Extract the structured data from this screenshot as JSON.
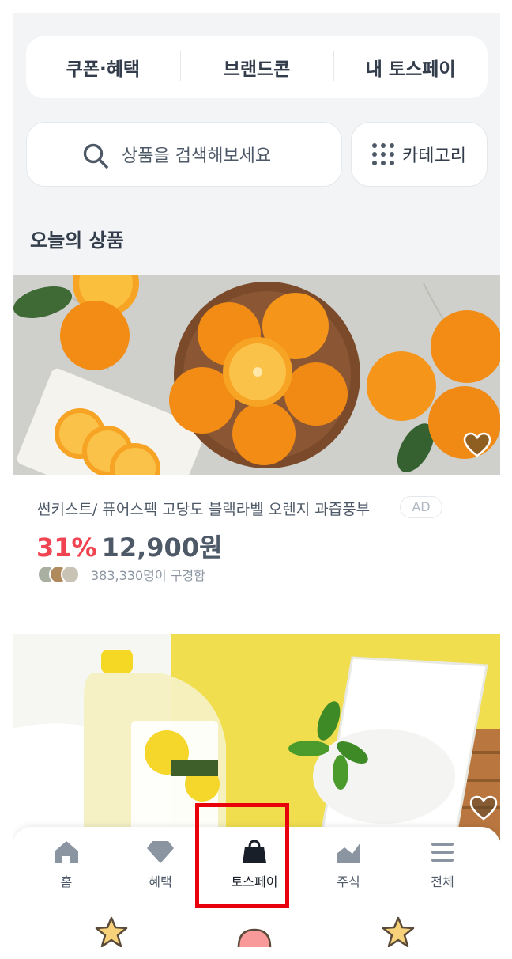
{
  "top_tabs": [
    "쿠폰·혜택",
    "브랜드콘",
    "내 토스페이"
  ],
  "search": {
    "placeholder": "상품을 검색해보세요"
  },
  "category_button": {
    "label": "카테고리"
  },
  "section": {
    "title": "오늘의 상품"
  },
  "products": [
    {
      "name": "썬키스트/ 퓨어스펙 고당도 블랙라벨 오렌지 과즙풍부",
      "ad_label": "AD",
      "discount": "31%",
      "price": "12,900원",
      "viewers": "383,330명이 구경함"
    }
  ],
  "bottom_nav": {
    "items": [
      {
        "label": "홈",
        "icon": "home-icon"
      },
      {
        "label": "혜택",
        "icon": "diamond-icon"
      },
      {
        "label": "토스페이",
        "icon": "shopping-bag-icon",
        "active": true
      },
      {
        "label": "주식",
        "icon": "stock-chart-icon"
      },
      {
        "label": "전체",
        "icon": "menu-icon"
      }
    ]
  },
  "colors": {
    "accent_red": "#f04452",
    "text_dark": "#333d4b",
    "highlight": "#e8000b"
  }
}
